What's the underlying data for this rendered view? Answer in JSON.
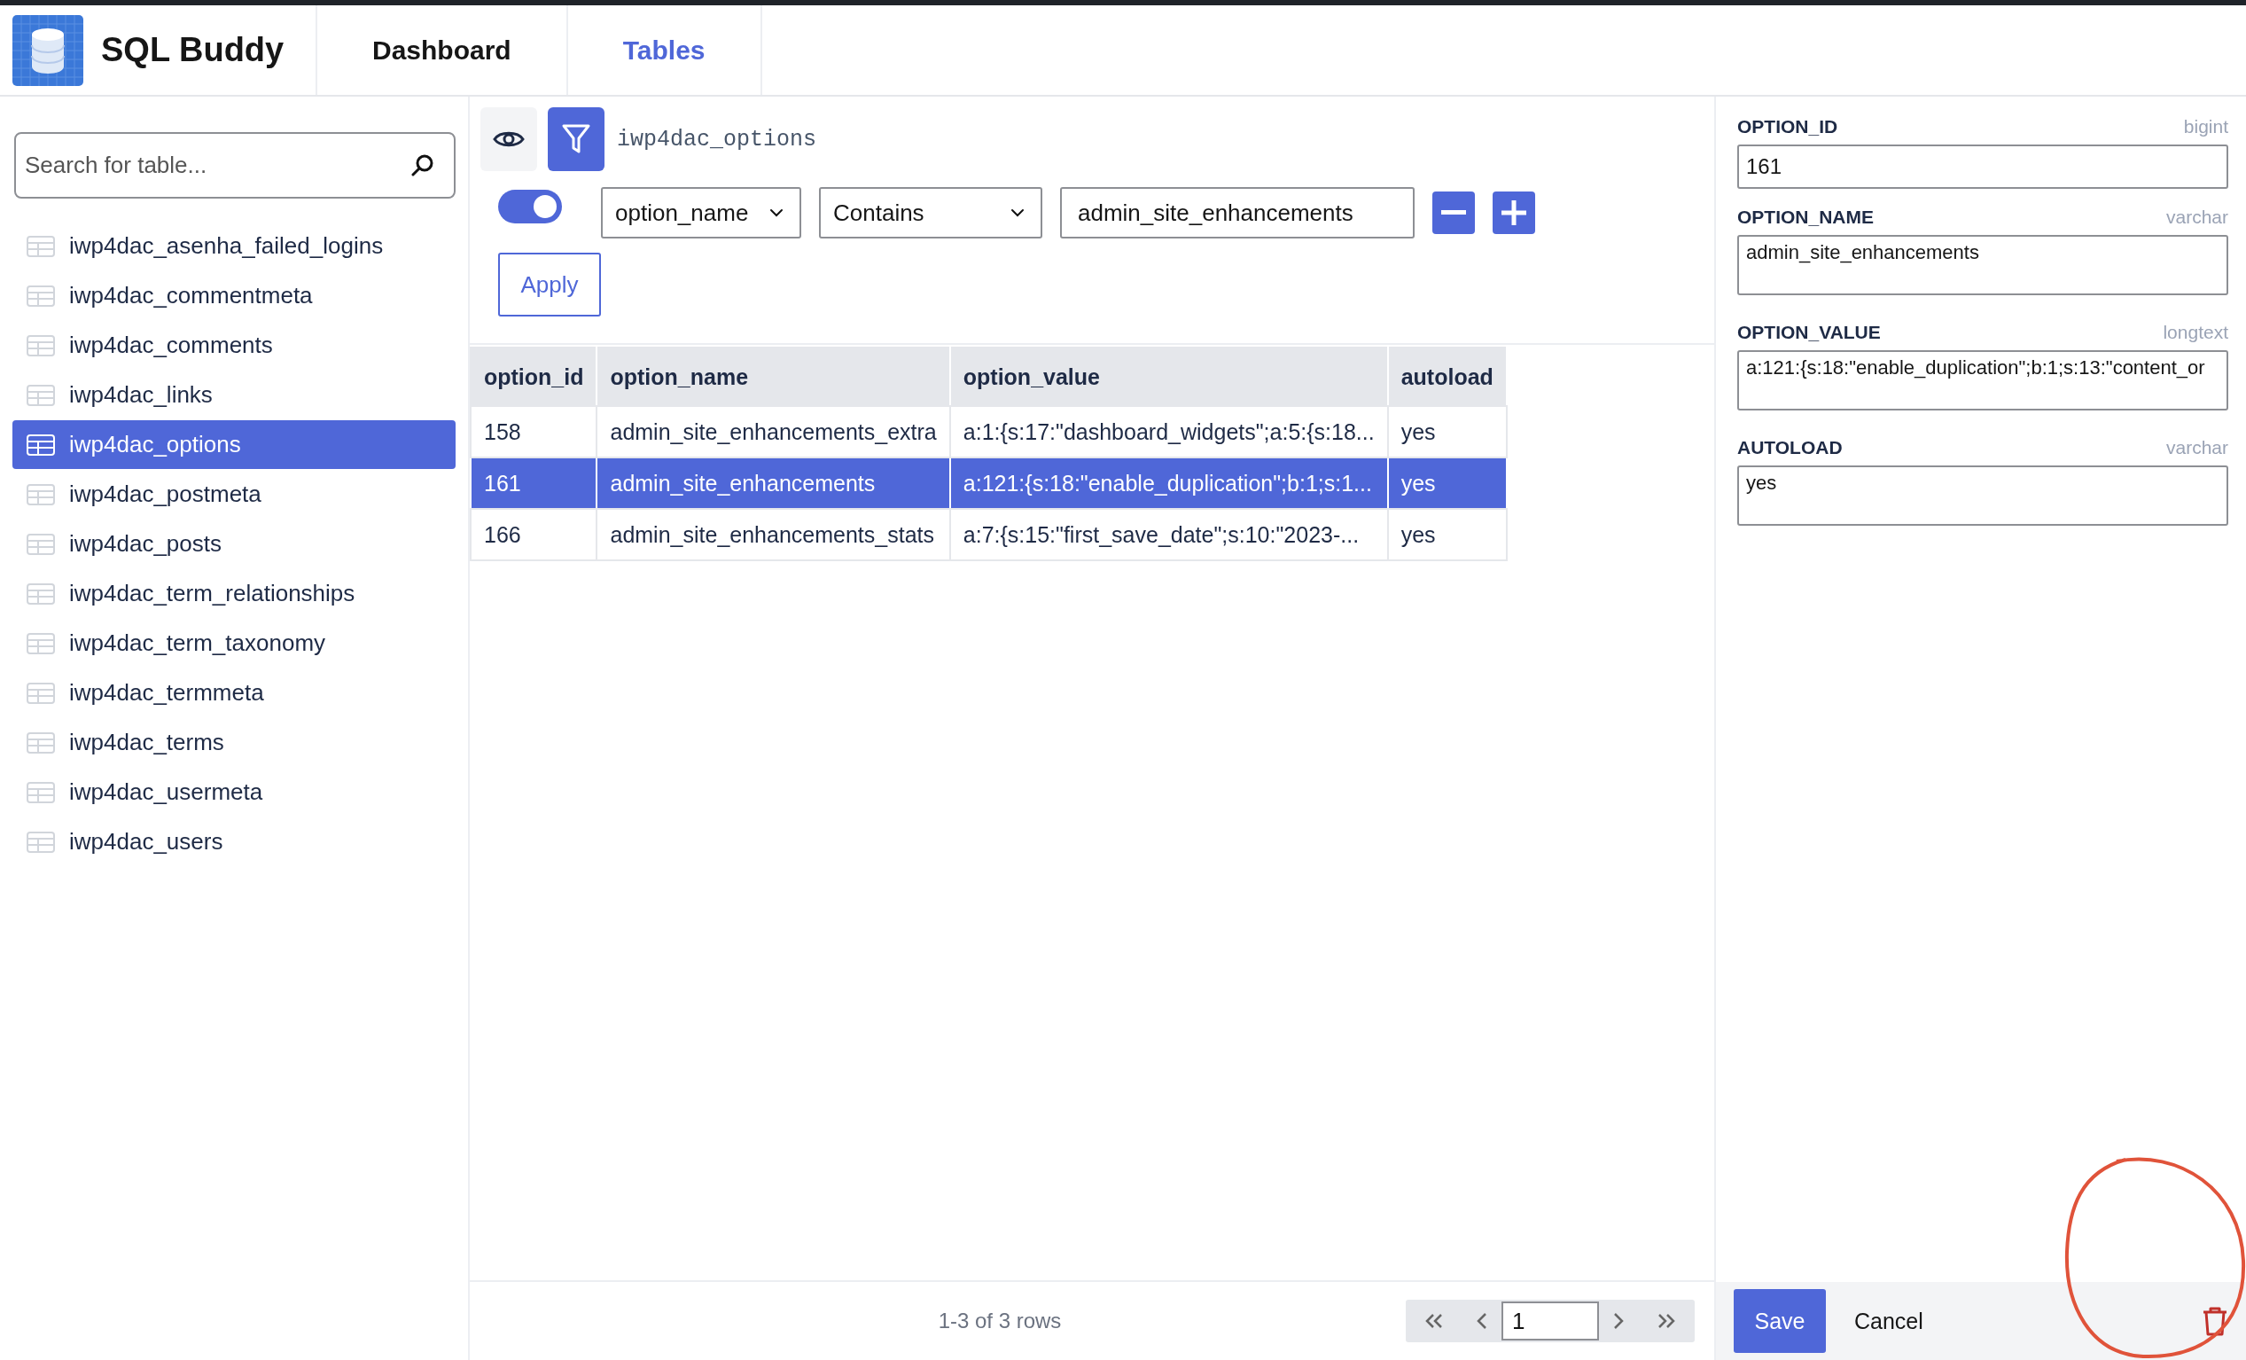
{
  "app": {
    "title": "SQL Buddy"
  },
  "nav": [
    {
      "label": "Dashboard",
      "selected": false
    },
    {
      "label": "Tables",
      "selected": true
    }
  ],
  "sidebar": {
    "search": {
      "placeholder": "Search for table..."
    },
    "items": [
      {
        "label": "iwp4dac_asenha_failed_logins",
        "selected": false
      },
      {
        "label": "iwp4dac_commentmeta",
        "selected": false
      },
      {
        "label": "iwp4dac_comments",
        "selected": false
      },
      {
        "label": "iwp4dac_links",
        "selected": false
      },
      {
        "label": "iwp4dac_options",
        "selected": true
      },
      {
        "label": "iwp4dac_postmeta",
        "selected": false
      },
      {
        "label": "iwp4dac_posts",
        "selected": false
      },
      {
        "label": "iwp4dac_term_relationships",
        "selected": false
      },
      {
        "label": "iwp4dac_term_taxonomy",
        "selected": false
      },
      {
        "label": "iwp4dac_termmeta",
        "selected": false
      },
      {
        "label": "iwp4dac_terms",
        "selected": false
      },
      {
        "label": "iwp4dac_usermeta",
        "selected": false
      },
      {
        "label": "iwp4dac_users",
        "selected": false
      }
    ]
  },
  "toolbar": {
    "filter_on": true,
    "table_name": "iwp4dac_options"
  },
  "filter": {
    "on": true,
    "column": "option_name",
    "operator": "Contains",
    "value": "admin_site_enhancements",
    "apply": "Apply"
  },
  "table": {
    "columns": [
      "option_id",
      "option_name",
      "option_value",
      "autoload"
    ],
    "rows": [
      {
        "cells": [
          "158",
          "admin_site_enhancements_extra",
          "a:1:{s:17:\"dashboard_widgets\";a:5:{s:18...",
          "yes"
        ],
        "selected": false
      },
      {
        "cells": [
          "161",
          "admin_site_enhancements",
          "a:121:{s:18:\"enable_duplication\";b:1;s:1...",
          "yes"
        ],
        "selected": true
      },
      {
        "cells": [
          "166",
          "admin_site_enhancements_stats",
          "a:7:{s:15:\"first_save_date\";s:10:\"2023-...",
          "yes"
        ],
        "selected": false
      }
    ]
  },
  "pagination": {
    "summary": "1-3 of 3 rows",
    "page": "1"
  },
  "editor": {
    "fields": [
      {
        "kind": "input",
        "label": "OPTION_ID",
        "type": "bigint",
        "value": "161"
      },
      {
        "kind": "textarea",
        "label": "OPTION_NAME",
        "type": "varchar",
        "value": "admin_site_enhancements"
      },
      {
        "kind": "textarea",
        "label": "OPTION_VALUE",
        "type": "longtext",
        "value": "a:121:{s:18:\"enable_duplication\";b:1;s:13:\"content_or"
      },
      {
        "kind": "textarea",
        "label": "AUTOLOAD",
        "type": "varchar",
        "value": "yes"
      }
    ],
    "save": "Save",
    "cancel": "Cancel"
  }
}
